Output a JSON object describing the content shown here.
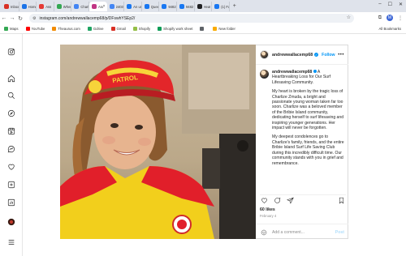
{
  "browser": {
    "tabs": [
      {
        "label": "Inbox",
        "color": "#d93025"
      },
      {
        "label": "Home",
        "color": "#1a73e8"
      },
      {
        "label": "Ass",
        "color": "#e53935"
      },
      {
        "label": "When",
        "color": "#34a853"
      },
      {
        "label": "Charlo",
        "color": "#4285f4"
      },
      {
        "label": "And",
        "color": "#c13584",
        "active": true
      },
      {
        "label": "2403",
        "color": "#4285f4"
      },
      {
        "label": "An un",
        "color": "#1877f2"
      },
      {
        "label": "Queen",
        "color": "#1877f2"
      },
      {
        "label": "9482",
        "color": "#1877f2"
      },
      {
        "label": "9482",
        "color": "#1877f2"
      },
      {
        "label": "Heat",
        "color": "#202124"
      },
      {
        "label": "(1) Fa",
        "color": "#1877f2"
      }
    ],
    "url": "instagram.com/andrewwallacemp68/p/DFswhYSEp2/",
    "profile_initial": "M",
    "bookmarks": [
      {
        "label": "Maps",
        "color": "#34a853"
      },
      {
        "label": "YouTube",
        "color": "#ff0000"
      },
      {
        "label": "Theaurus.com",
        "color": "#f28b00"
      },
      {
        "label": "Gdrive",
        "color": "#1fa463"
      },
      {
        "label": "Gmail",
        "color": "#d93025"
      },
      {
        "label": "Shopify",
        "color": "#95bf47"
      },
      {
        "label": "Shopify work sheet",
        "color": "#0f9d58"
      },
      {
        "label": "",
        "color": "#5f6368"
      },
      {
        "label": "New folder",
        "color": "#f9ab00"
      }
    ],
    "all_bookmarks": "All Bookmarks"
  },
  "post": {
    "username": "andrewwallacemp68",
    "follow": "Follow",
    "more": "•••",
    "caption_lead": "A Heartbreaking Loss for Our Surf Lifesaving Community.",
    "paragraphs": [
      "My heart is broken by the tragic loss of Charlize Zmuda, a bright and passionate young woman taken far too soon. Charlize was a beloved member of the Bribie Island community, dedicating herself to surf lifesaving and inspiring younger generations. Her impact will never be forgotten.",
      "My deepest condolences go to Charlize's family, friends, and the entire Bribie Island Surf Life Saving Club during this incredibly difficult time. Our community stands with you in grief and remembrance."
    ],
    "likes": "60 likes",
    "date": "February 4",
    "comment_placeholder": "Add a comment...",
    "post_button": "Post",
    "cap_text": "PATROL"
  }
}
